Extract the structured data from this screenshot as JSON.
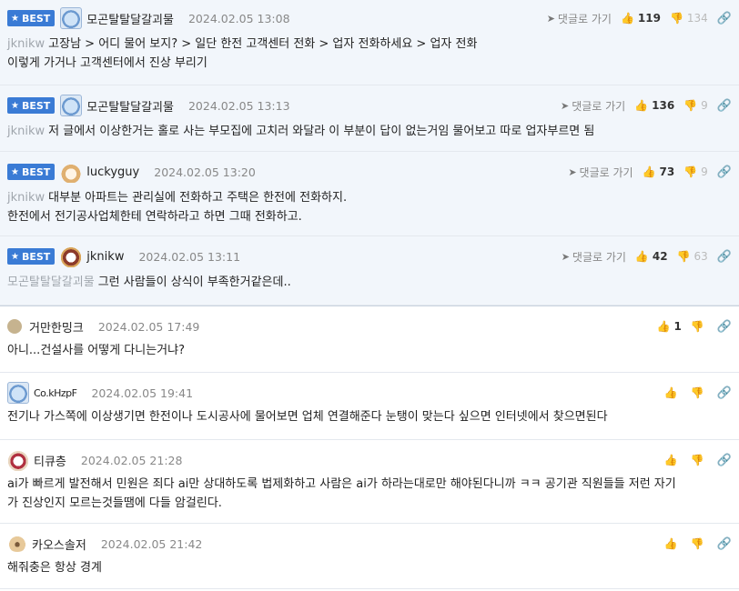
{
  "labels": {
    "best": "BEST",
    "reply": "댓글로 가기"
  },
  "icons": {
    "star": "star-icon",
    "reply": "reply-arrow-icon",
    "up": "thumbs-up-icon",
    "down": "thumbs-down-icon",
    "link": "link-icon"
  },
  "colors": {
    "best_badge": "#3a7bd5",
    "best_bg": "#f2f6fb",
    "mention": "#a0a6ad"
  },
  "comments": [
    {
      "nick": "모곤탈탈달갈괴물",
      "date": "2024.02.05 13:08",
      "up": "119",
      "down": "134",
      "mention": "jknikw",
      "line1": "고장남 > 어디 물어 보지? > 일단 한전 고객센터 전화 > 업자 전화하세요 > 업자 전화",
      "line2": "이렇게 가거나 고객센터에서 진상 부리기"
    },
    {
      "nick": "모곤탈탈달갈괴물",
      "date": "2024.02.05 13:13",
      "up": "136",
      "down": "9",
      "mention": "jknikw",
      "line1": "저 글에서 이상한거는 홀로 사는 부모집에 고치러 와달라 이 부분이 답이 없는거임 물어보고 따로 업자부르면 됨"
    },
    {
      "nick": "luckyguy",
      "date": "2024.02.05 13:20",
      "up": "73",
      "down": "9",
      "mention": "jknikw",
      "line1": "대부분 아파트는 관리실에 전화하고 주택은 한전에 전화하지.",
      "line2": "한전에서 전기공사업체한테 연락하라고 하면 그때 전화하고."
    },
    {
      "nick": "jknikw",
      "date": "2024.02.05 13:11",
      "up": "42",
      "down": "63",
      "mention": "모곤탈탈달갈괴물",
      "line1": "그런 사람들이 상식이 부족한거같은데.."
    },
    {
      "nick": "거만한밍크",
      "date": "2024.02.05 17:49",
      "up": "1",
      "line1": "아니...건설사를 어떻게 다니는거냐?"
    },
    {
      "nick": "Co.kHzpF",
      "date": "2024.02.05 19:41",
      "line1": "전기나 가스쪽에 이상생기면 한전이나 도시공사에 물어보면 업체 연결해준다 눈탱이 맞는다 싶으면 인터넷에서 찾으면된다"
    },
    {
      "nick": "티큐층",
      "date": "2024.02.05 21:28",
      "line1": "ai가 빠르게 발전해서 민원은 죄다 ai만 상대하도록 법제화하고 사람은 ai가 하라는대로만 해야된다니까 ㅋㅋ 공기관 직원들들 저런 자기",
      "line2": "가 진상인지 모르는것들땜에 다들 암걸린다."
    },
    {
      "nick": "카오스솔저",
      "date": "2024.02.05 21:42",
      "line1": "해줘충은 항상 경계"
    }
  ]
}
